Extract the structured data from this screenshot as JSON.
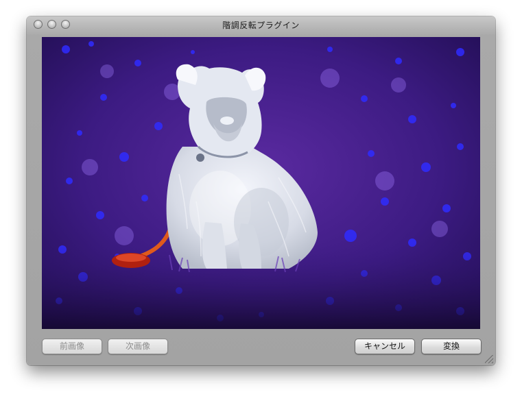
{
  "window": {
    "title": "階調反転プラグイン"
  },
  "image": {
    "description_icon": "inverted-dog-photo"
  },
  "buttons": {
    "prev_label": "前画像",
    "next_label": "次画像",
    "cancel_label": "キャンセル",
    "convert_label": "変換"
  },
  "colors": {
    "background_purple": "#3a1a7a",
    "flower_blue": "#2a3cff",
    "dog_white": "#dfe4ee",
    "leash_orange": "#e05a1c"
  }
}
